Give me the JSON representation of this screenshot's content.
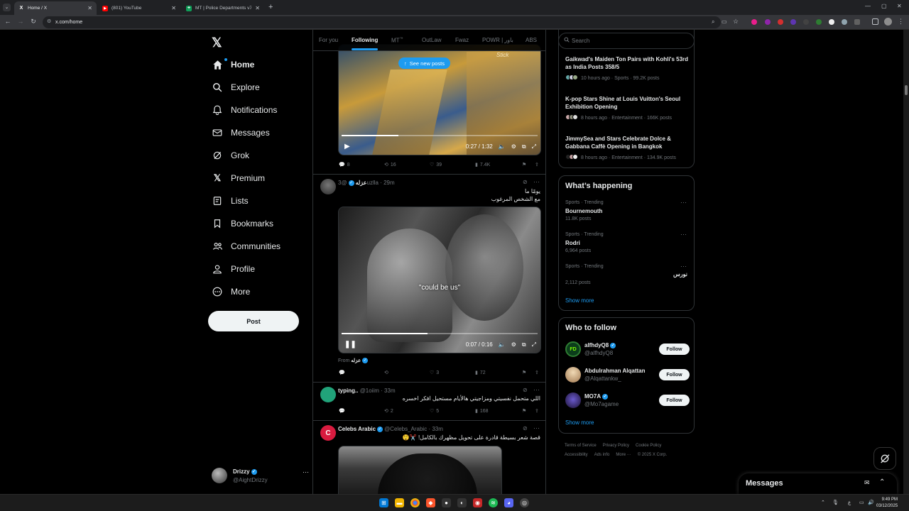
{
  "browser": {
    "tabs": [
      {
        "title": "Home / X",
        "favicon": "X",
        "active": true
      },
      {
        "title": "(801) YouTube",
        "favicon": "▶",
        "active": false
      },
      {
        "title": "MT | Police Departments v7.0",
        "favicon": "+",
        "active": false
      }
    ],
    "url": "x.com/home"
  },
  "nav": {
    "items": [
      {
        "label": "Home",
        "icon": "home-icon"
      },
      {
        "label": "Explore",
        "icon": "search-icon"
      },
      {
        "label": "Notifications",
        "icon": "bell-icon"
      },
      {
        "label": "Messages",
        "icon": "envelope-icon"
      },
      {
        "label": "Grok",
        "icon": "grok-icon"
      },
      {
        "label": "Premium",
        "icon": "x-logo-icon"
      },
      {
        "label": "Lists",
        "icon": "list-icon"
      },
      {
        "label": "Bookmarks",
        "icon": "bookmark-icon"
      },
      {
        "label": "Communities",
        "icon": "people-icon"
      },
      {
        "label": "Profile",
        "icon": "person-icon"
      },
      {
        "label": "More",
        "icon": "more-circle-icon"
      }
    ],
    "post_label": "Post",
    "account": {
      "name": "Drizzy",
      "handle": "@AightDrizzy"
    }
  },
  "feed": {
    "tabs": [
      "For you",
      "Following",
      "MT",
      "OutLaw",
      "Fwaz",
      "POWR | باور",
      "ABS"
    ],
    "mt_badge": "™",
    "see_new_posts": "See new posts",
    "video1": {
      "time": "0:27 / 1:32",
      "progress": 0.29,
      "watermark": "Stick"
    },
    "post1_actions": {
      "replies": "8",
      "reposts": "16",
      "likes": "39",
      "views": "7.4K"
    },
    "post2": {
      "name": "عزله",
      "handle": "@3uzlla",
      "time": "29m",
      "text1": "يومًا ما",
      "text2": "مع الشخص المرغوب",
      "caption": "\"could be us\"",
      "video_time": "0:07 / 0:16",
      "progress": 0.44,
      "from_label": "From",
      "from_name": "عزله",
      "actions": {
        "replies": "",
        "reposts": "",
        "likes": "3",
        "views": "72"
      }
    },
    "post3": {
      "name": "typing..",
      "handle": "@1oiim",
      "time": "33m",
      "text": "اللي متحمل نفسيتي ومزاجيتي هالأيام مستحيل افكر اخسره",
      "actions": {
        "replies": "",
        "reposts": "2",
        "likes": "5",
        "views": "168"
      }
    },
    "post4": {
      "name": "Celebs Arabic",
      "handle": "@Celebs_Arabic",
      "time": "33m",
      "text": "قصة شعر بسيطة قادرة على تحويل مظهرك بالكامل! ✂️😲"
    }
  },
  "right": {
    "search_placeholder": "Search",
    "news": [
      {
        "title": "Gaikwad's Maiden Ton Pairs with Kohli's 53rd as India Posts 358/5",
        "meta": "10 hours ago · Sports · 99.2K posts"
      },
      {
        "title": "K-pop Stars Shine at Louis Vuitton's Seoul Exhibition Opening",
        "meta": "8 hours ago · Entertainment · 166K posts"
      },
      {
        "title": "JimmySea and Stars Celebrate Dolce & Gabbana Caffè Opening in Bangkok",
        "meta": "8 hours ago · Entertainment · 134.9K posts"
      }
    ],
    "happening_title": "What’s happening",
    "trends": [
      {
        "category": "Sports · Trending",
        "name": "Bournemouth",
        "count": "11.8K posts"
      },
      {
        "category": "Sports · Trending",
        "name": "Rodri",
        "count": "6,964 posts"
      },
      {
        "category": "Sports · Trending",
        "name": "نورس",
        "count": "2,112 posts"
      }
    ],
    "show_more": "Show more",
    "wtf_title": "Who to follow",
    "wtf": [
      {
        "name": "alfhdyQ8",
        "handle": "@alfhdyQ8",
        "button": "Follow"
      },
      {
        "name": "Abdulrahman Alqattan",
        "handle": "@Alqattankw_",
        "button": "Follow"
      },
      {
        "name": "MO7A",
        "handle": "@Mo7agame",
        "button": "Follow"
      }
    ],
    "footer": [
      "Terms of Service",
      "Privacy Policy",
      "Cookie Policy",
      "Accessibility",
      "Ads info",
      "More ···",
      "© 2025 X Corp."
    ]
  },
  "messages_drawer": {
    "title": "Messages"
  },
  "taskbar": {
    "time": "9:49 PM",
    "date": "03/12/2025"
  },
  "colors": {
    "accent": "#1d9bf0",
    "bg": "#000000",
    "border": "#2f3336"
  }
}
